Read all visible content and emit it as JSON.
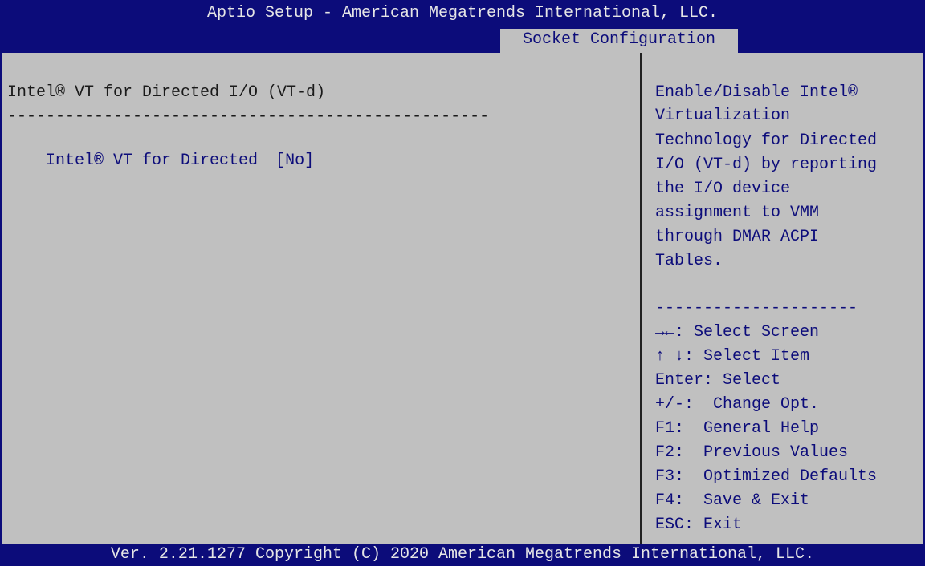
{
  "header": {
    "title": "Aptio Setup - American Megatrends International, LLC.",
    "active_tab": "Socket Configuration"
  },
  "main": {
    "section_title": "Intel® VT for Directed I/O (VT-d)",
    "separator": "--------------------------------------------------",
    "setting": {
      "label": "Intel® VT for Directed",
      "value": "[No]"
    }
  },
  "help": {
    "lines": [
      "Enable/Disable Intel®",
      "Virtualization",
      "Technology for Directed",
      "I/O (VT-d) by reporting",
      "the I/O device",
      "assignment to VMM",
      "through DMAR ACPI",
      "Tables."
    ],
    "separator": "---------------------",
    "keys": [
      "→←: Select Screen",
      "↑ ↓: Select Item",
      "Enter: Select",
      "+/-:  Change Opt.",
      "F1:  General Help",
      "F2:  Previous Values",
      "F3:  Optimized Defaults",
      "F4:  Save & Exit",
      "ESC: Exit"
    ]
  },
  "footer": {
    "text": "Ver. 2.21.1277 Copyright (C) 2020 American Megatrends International, LLC."
  },
  "colors": {
    "blue": "#0c0c7a",
    "gray": "#c0c0c0"
  }
}
